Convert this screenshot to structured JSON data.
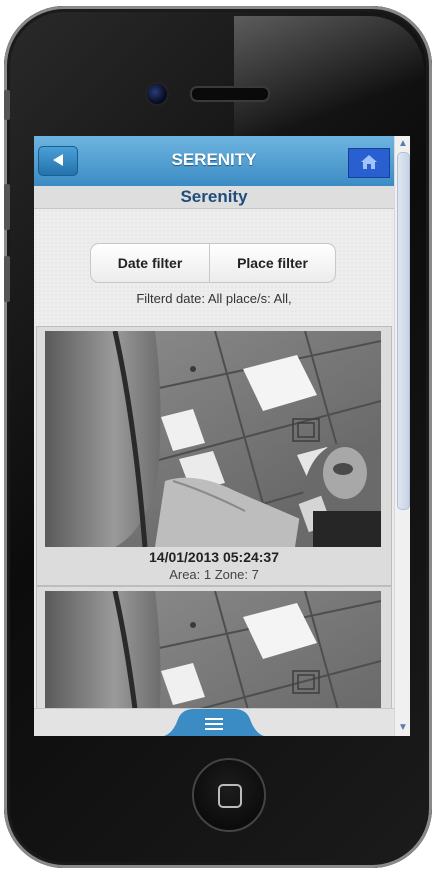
{
  "app": {
    "title": "SERENITY",
    "subtitle": "Serenity"
  },
  "filters": {
    "date_label": "Date filter",
    "place_label": "Place filter",
    "status": "Filterd date: All place/s: All,"
  },
  "events": [
    {
      "timestamp": "14/01/2013 05:24:37",
      "location": "Area: 1 Zone: 7"
    },
    {
      "timestamp": "",
      "location": ""
    }
  ],
  "icons": {
    "back": "back-arrow-icon",
    "home": "home-icon",
    "menu": "menu-icon"
  },
  "colors": {
    "header_blue": "#3b8cc4",
    "home_button_blue": "#2a5fcf",
    "subtitle_text": "#1e4e79"
  }
}
